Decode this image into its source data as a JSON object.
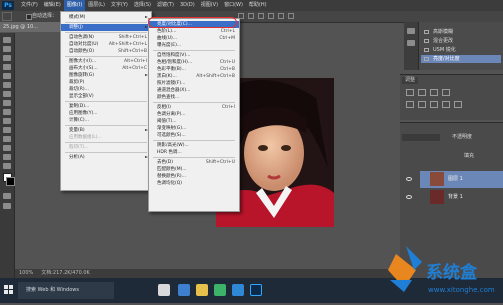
{
  "app": {
    "logo": "Ps"
  },
  "menubar": {
    "items": [
      "文件(F)",
      "编辑(E)",
      "图像(I)",
      "图层(L)",
      "文字(Y)",
      "选择(S)",
      "滤镜(T)",
      "3D(D)",
      "视图(V)",
      "窗口(W)",
      "帮助(H)"
    ],
    "active_index": 2
  },
  "options_bar": {
    "label": "自动选择："
  },
  "document": {
    "tab": "25.jpg @ 10..."
  },
  "status_bar": {
    "zoom": "100%",
    "doc_info": "文档:217.2K/470.0K"
  },
  "image_menu": {
    "items": [
      {
        "label": "模式(M)",
        "shortcut": "",
        "submenu": true
      },
      {
        "sep": true
      },
      {
        "label": "调整(J)",
        "shortcut": "",
        "submenu": true,
        "highlight": true
      },
      {
        "sep": true
      },
      {
        "label": "自动色调(N)",
        "shortcut": "Shift+Ctrl+L"
      },
      {
        "label": "自动对比度(U)",
        "shortcut": "Alt+Shift+Ctrl+L"
      },
      {
        "label": "自动颜色(O)",
        "shortcut": "Shift+Ctrl+B"
      },
      {
        "sep": true
      },
      {
        "label": "图像大小(I)...",
        "shortcut": "Alt+Ctrl+I"
      },
      {
        "label": "画布大小(S)...",
        "shortcut": "Alt+Ctrl+C"
      },
      {
        "label": "图像旋转(G)",
        "shortcut": "",
        "submenu": true
      },
      {
        "label": "裁剪(P)",
        "shortcut": ""
      },
      {
        "label": "裁切(R)...",
        "shortcut": ""
      },
      {
        "label": "显示全部(V)",
        "shortcut": ""
      },
      {
        "sep": true
      },
      {
        "label": "复制(D)...",
        "shortcut": ""
      },
      {
        "label": "应用图像(Y)...",
        "shortcut": ""
      },
      {
        "label": "计算(C)...",
        "shortcut": ""
      },
      {
        "sep": true
      },
      {
        "label": "变量(B)",
        "shortcut": "",
        "submenu": true
      },
      {
        "label": "应用数据组(L)...",
        "shortcut": "",
        "disabled": true
      },
      {
        "sep": true
      },
      {
        "label": "陷印(T)...",
        "shortcut": "",
        "disabled": true
      },
      {
        "sep": true
      },
      {
        "label": "分析(A)",
        "shortcut": "",
        "submenu": true
      }
    ]
  },
  "adjust_menu": {
    "items": [
      {
        "label": "亮度/对比度(C)...",
        "shortcut": "",
        "highlight": true
      },
      {
        "label": "色阶(L)...",
        "shortcut": "Ctrl+L"
      },
      {
        "label": "曲线(U)...",
        "shortcut": "Ctrl+M"
      },
      {
        "label": "曝光度(E)...",
        "shortcut": ""
      },
      {
        "sep": true
      },
      {
        "label": "自然饱和度(V)...",
        "shortcut": ""
      },
      {
        "label": "色相/饱和度(H)...",
        "shortcut": "Ctrl+U"
      },
      {
        "label": "色彩平衡(B)...",
        "shortcut": "Ctrl+B"
      },
      {
        "label": "黑白(K)...",
        "shortcut": "Alt+Shift+Ctrl+B"
      },
      {
        "label": "照片滤镜(F)...",
        "shortcut": ""
      },
      {
        "label": "通道混合器(X)...",
        "shortcut": ""
      },
      {
        "label": "颜色查找...",
        "shortcut": ""
      },
      {
        "sep": true
      },
      {
        "label": "反相(I)",
        "shortcut": "Ctrl+I"
      },
      {
        "label": "色调分离(P)...",
        "shortcut": ""
      },
      {
        "label": "阈值(T)...",
        "shortcut": ""
      },
      {
        "label": "渐变映射(G)...",
        "shortcut": ""
      },
      {
        "label": "可选颜色(S)...",
        "shortcut": ""
      },
      {
        "sep": true
      },
      {
        "label": "阴影/高光(W)...",
        "shortcut": ""
      },
      {
        "label": "HDR 色调...",
        "shortcut": ""
      },
      {
        "sep": true
      },
      {
        "label": "去色(D)",
        "shortcut": "Shift+Ctrl+U"
      },
      {
        "label": "匹配颜色(M)...",
        "shortcut": ""
      },
      {
        "label": "替换颜色(R)...",
        "shortcut": ""
      },
      {
        "label": "色调均化(Q)",
        "shortcut": ""
      }
    ]
  },
  "history_panel": {
    "items": [
      "高斯模糊",
      "混合更改",
      "USM 锐化",
      "亮度/对比度"
    ],
    "selected_index": 3
  },
  "adjustments_panel": {
    "tab": "调整"
  },
  "layers_panel": {
    "mode": "不透明度",
    "fill_label": "填充",
    "layers": [
      {
        "name": "图层 1",
        "selected": true
      },
      {
        "name": "背景 1",
        "selected": false
      }
    ]
  },
  "taskbar": {
    "search_placeholder": "搜索 Web 和 Windows"
  },
  "watermark": {
    "brand": "系统盒",
    "url": "www.xitonghe.com"
  }
}
